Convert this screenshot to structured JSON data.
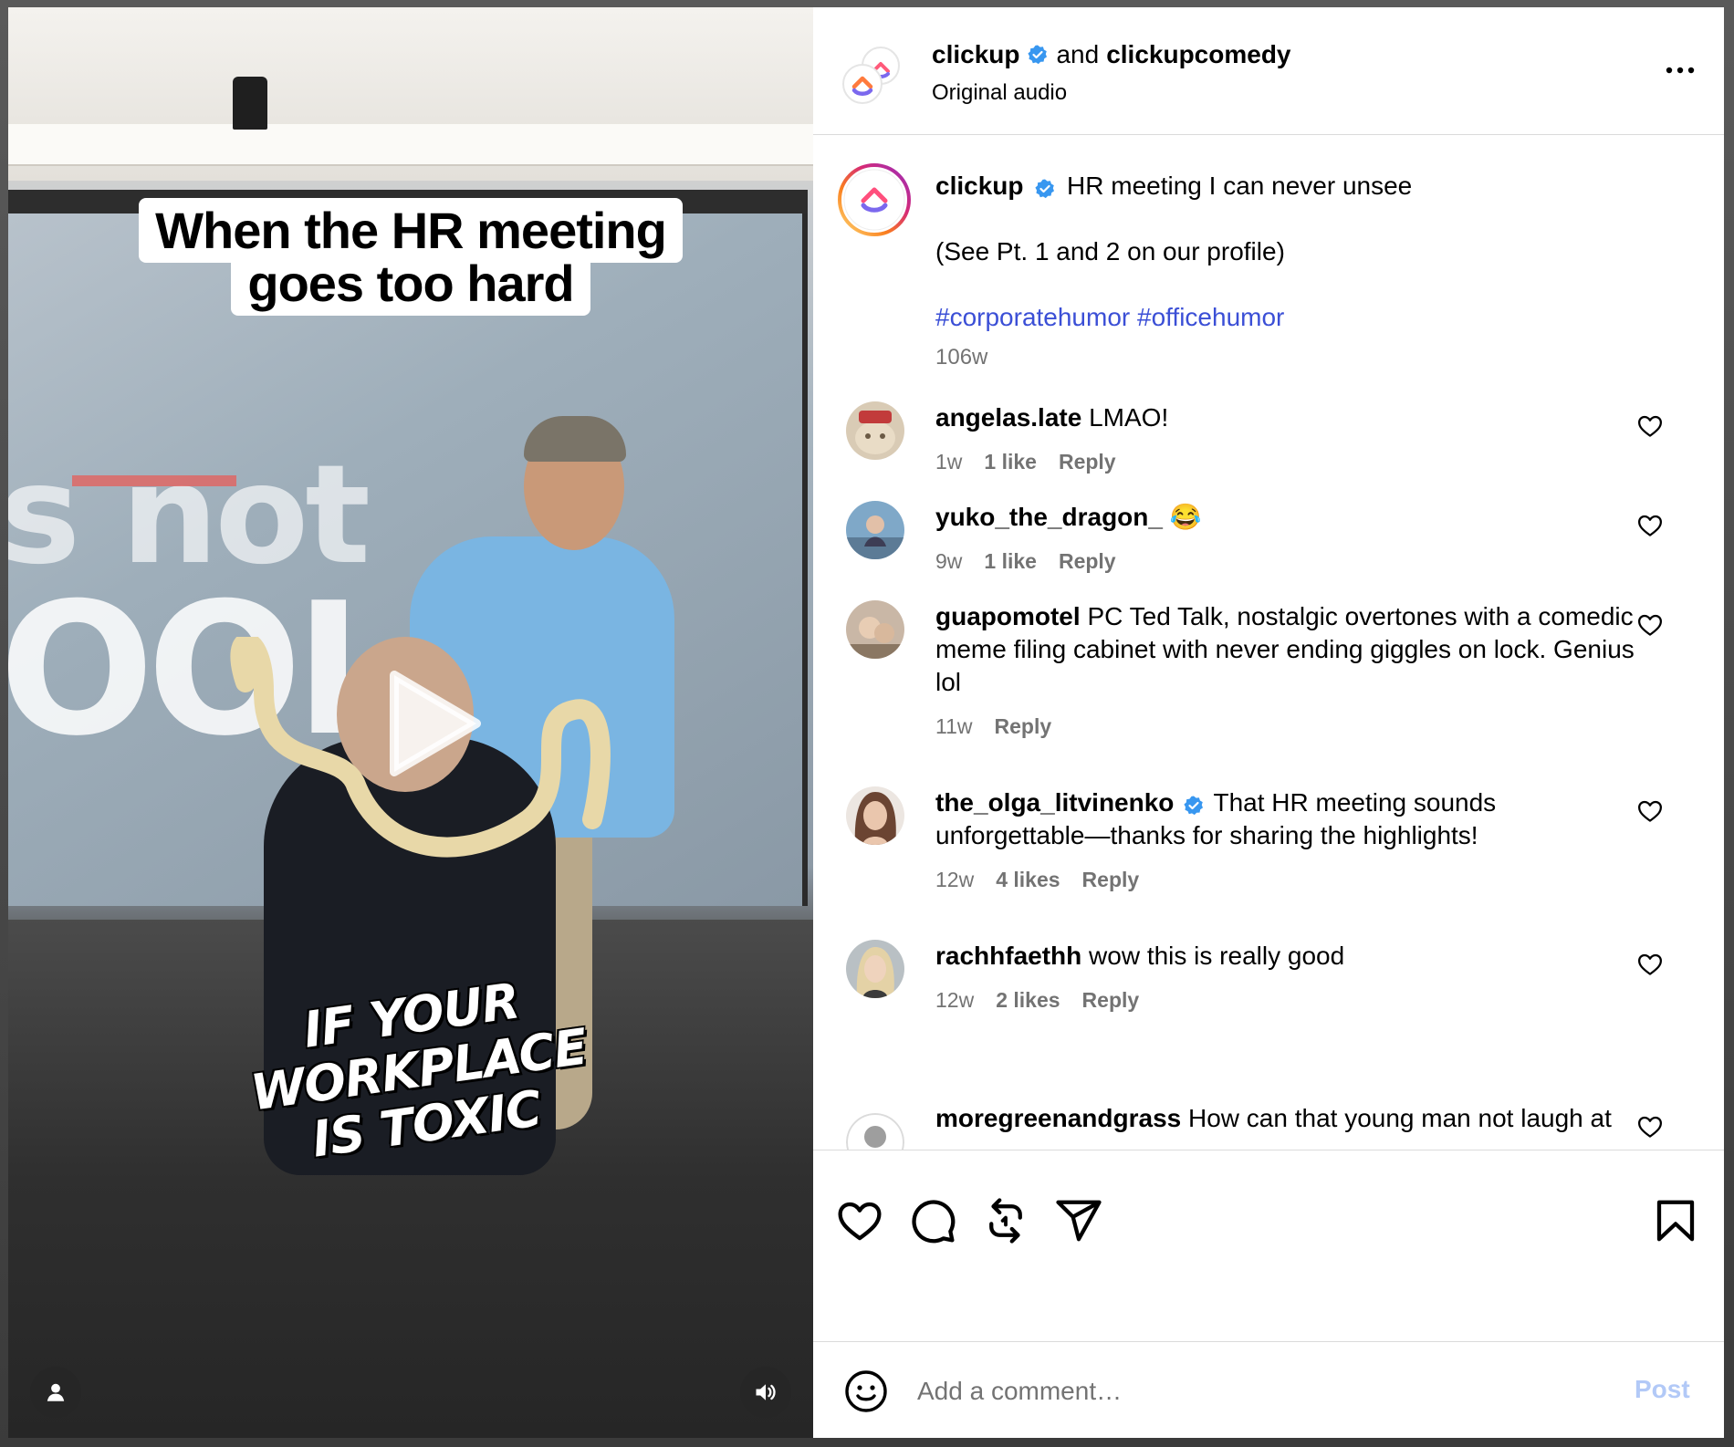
{
  "video": {
    "caption_top_line1": "When the HR meeting",
    "caption_top_line2": "goes too hard",
    "caption_bottom_line1": "IF YOUR WORKPLACE",
    "caption_bottom_line2": "IS TOXIC",
    "screen_word_1": "s not",
    "screen_word_2": "OOL"
  },
  "header": {
    "account": "clickup",
    "joiner": "and",
    "collab_account": "clickupcomedy",
    "audio": "Original audio"
  },
  "caption": {
    "account": "clickup",
    "text": "HR meeting I can never unsee",
    "line2": "(See Pt. 1 and 2 on our profile)",
    "hashtag1": "#corporatehumor",
    "hashtag2": "#officehumor",
    "time": "106w"
  },
  "comments": [
    {
      "user": "angelas.late",
      "text": "LMAO!",
      "time": "1w",
      "likes": "1 like",
      "reply": "Reply",
      "verified": false
    },
    {
      "user": "yuko_the_dragon_",
      "text": "😂",
      "time": "9w",
      "likes": "1 like",
      "reply": "Reply",
      "verified": false
    },
    {
      "user": "guapomotel",
      "text": "PC Ted Talk, nostalgic overtones with a comedic meme filing cabinet with never ending giggles on lock. Genius lol",
      "time": "11w",
      "likes": "",
      "reply": "Reply",
      "verified": false
    },
    {
      "user": "the_olga_litvinenko",
      "text": "That HR meeting sounds unforgettable—thanks for sharing the highlights!",
      "time": "12w",
      "likes": "4 likes",
      "reply": "Reply",
      "verified": true
    },
    {
      "user": "rachhfaethh",
      "text": "wow this is really good",
      "time": "12w",
      "likes": "2 likes",
      "reply": "Reply",
      "verified": false
    },
    {
      "user": "moregreenandgrass",
      "text": "How can that young man not laugh at",
      "time": "",
      "likes": "",
      "reply": "",
      "verified": false
    }
  ],
  "comment_box": {
    "placeholder": "Add a comment…",
    "post_label": "Post"
  },
  "icons": {
    "like": "heart-icon",
    "comment": "comment-bubble-icon",
    "repost": "repost-icon",
    "share": "paper-plane-icon",
    "save": "bookmark-icon",
    "more": "more-dots-icon",
    "emoji": "emoji-icon",
    "play": "play-icon",
    "sound": "speaker-icon",
    "tagged_user": "user-icon"
  },
  "colors": {
    "verified": "#3897f0",
    "hashtag": "#3b4fd6",
    "muted_text": "#737373",
    "post_button_disabled": "#b2c9f7"
  }
}
